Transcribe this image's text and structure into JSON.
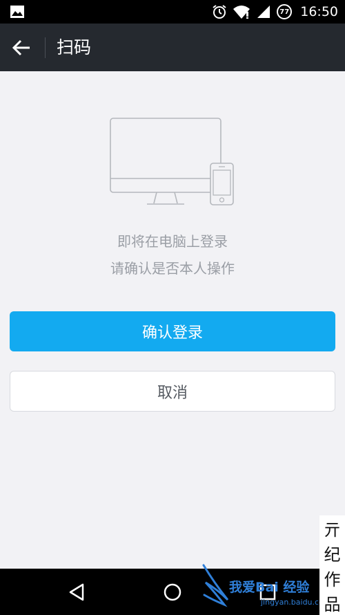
{
  "status_bar": {
    "time": "16:50",
    "battery_level": "77",
    "icons": [
      "gallery-icon",
      "alarm-icon",
      "wifi-icon",
      "signal-icon",
      "battery-icon"
    ]
  },
  "header": {
    "title": "扫码",
    "back_icon": "arrow-left-icon"
  },
  "illustration": {
    "icon": "monitor-and-phone-icon"
  },
  "message": {
    "line1": "即将在电脑上登录",
    "line2": "请确认是否本人操作"
  },
  "buttons": {
    "confirm_label": "确认登录",
    "cancel_label": "取消"
  },
  "watermark": {
    "stamp_chars": [
      "亓",
      "纪",
      "作",
      "品"
    ],
    "site_text": "我爱Bai 经验",
    "site_url": "jingyan.baidu.com"
  },
  "nav_bar": {
    "icons": [
      "nav-back-icon",
      "nav-home-icon",
      "nav-recent-apps-icon"
    ]
  },
  "colors": {
    "header_bg": "#25292f",
    "primary_button": "#13aaf0",
    "page_bg": "#f2f2f5",
    "message_text": "#9a9ea5"
  }
}
